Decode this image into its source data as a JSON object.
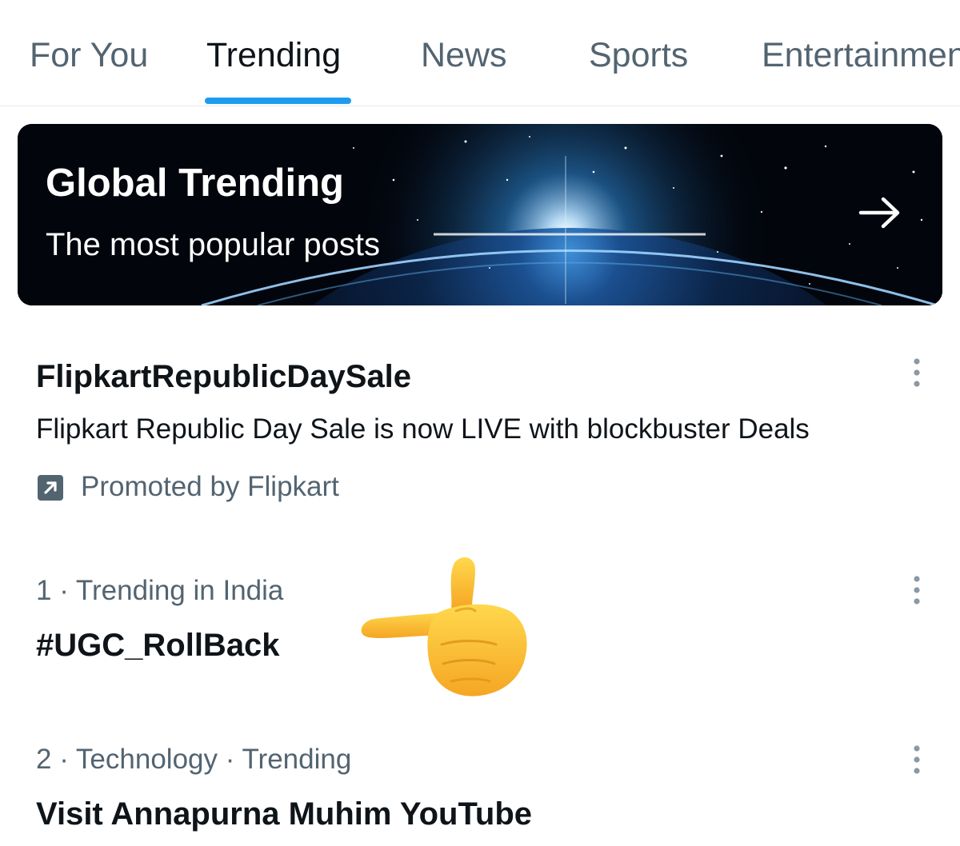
{
  "tabs": [
    {
      "label": "For You",
      "active": false
    },
    {
      "label": "Trending",
      "active": true
    },
    {
      "label": "News",
      "active": false
    },
    {
      "label": "Sports",
      "active": false
    },
    {
      "label": "Entertainment",
      "active": false
    }
  ],
  "banner": {
    "title": "Global Trending",
    "subtitle": "The most popular posts",
    "arrow_icon": "arrow-right-icon"
  },
  "promoted_trend": {
    "title": "FlipkartRepublicDaySale",
    "description": "Flipkart Republic Day Sale is now LIVE with blockbuster Deals",
    "promoted_label": "Promoted by Flipkart",
    "promoted_icon": "promoted-arrow-icon"
  },
  "trends": [
    {
      "meta": "1 · Trending in India",
      "title": "#UGC_RollBack"
    },
    {
      "meta": "2 · Technology · Trending",
      "title": "Visit Annapurna Muhim YouTube"
    }
  ],
  "emoji": {
    "name": "backhand-index-pointing-left-emoji"
  },
  "colors": {
    "accent": "#1d9bf0",
    "text_primary": "#0f1419",
    "text_secondary": "#536471",
    "divider": "#e6ecf0",
    "banner_bg": "#02050c"
  }
}
